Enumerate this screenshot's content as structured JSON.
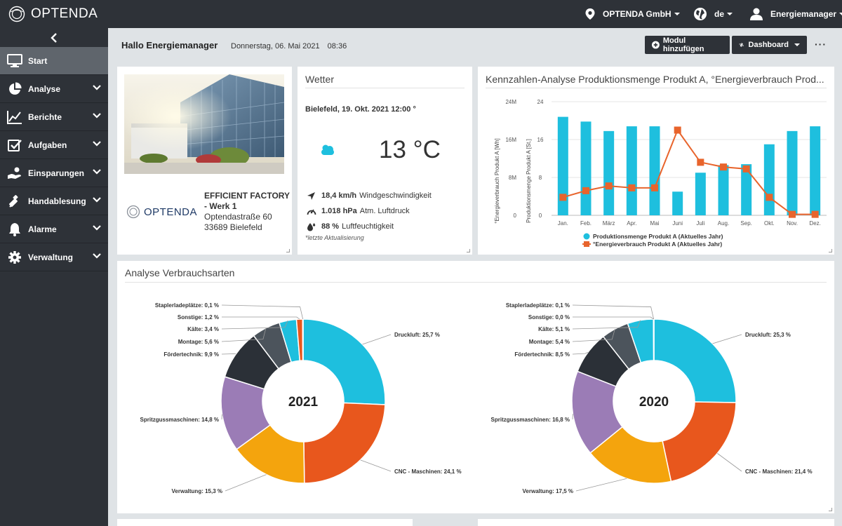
{
  "topbar": {
    "logo_text": "OPTENDA",
    "company": "OPTENDA GmbH",
    "language": "de",
    "user": "Energiemanager"
  },
  "sidebar": {
    "items": [
      {
        "label": "Start",
        "icon": "monitor-icon"
      },
      {
        "label": "Analyse",
        "icon": "pie-chart-icon"
      },
      {
        "label": "Berichte",
        "icon": "line-chart-icon"
      },
      {
        "label": "Aufgaben",
        "icon": "checkbox-icon"
      },
      {
        "label": "Einsparungen",
        "icon": "savings-hand-icon"
      },
      {
        "label": "Handablesung",
        "icon": "meter-icon"
      },
      {
        "label": "Alarme",
        "icon": "bell-icon"
      },
      {
        "label": "Verwaltung",
        "icon": "gear-icon"
      }
    ]
  },
  "header": {
    "greeting": "Hallo Energiemanager",
    "date": "Donnerstag, 06. Mai 2021",
    "time": "08:36",
    "add_module_label": "Modul hinzufügen",
    "dashboard_label": "Dashboard",
    "more_label": "···"
  },
  "factory": {
    "name_line1": "EFFICIENT FACTORY",
    "name_line2": "- Werk 1",
    "street": "Optendastraße 60",
    "city": "33689 Bielefeld",
    "logo_text": "OPTENDA"
  },
  "weather": {
    "title": "Wetter",
    "location": "Bielefeld, 19. Okt. 2021 12:00 °",
    "temperature": "13 °C",
    "wind_value": "18,4 km/h",
    "wind_label": "Windgeschwindigkeit",
    "pressure_value": "1.018 hPa",
    "pressure_label": "Atm. Luftdruck",
    "humidity_value": "88 %",
    "humidity_label": "Luftfeuchtigkeit",
    "note": "*letzte Aktualisierung"
  },
  "analysis_card": {
    "title": "Analyse Verbrauchsarten"
  },
  "chart_data": [
    {
      "type": "bar",
      "title": "Kennzahlen-Analyse Produktionsmenge Produkt A, °Energieverbrauch Prod...",
      "categories": [
        "Jan.",
        "Feb.",
        "März",
        "Apr.",
        "Mai",
        "Juni",
        "Juli",
        "Aug.",
        "Sep.",
        "Okt.",
        "Nov.",
        "Dez."
      ],
      "y_left_label": "°Energieverbrauch Produkt A [Wh]",
      "y_left_ticks": [
        "0",
        "8M",
        "16M",
        "24M"
      ],
      "y_left_lim": [
        0,
        24000000
      ],
      "y_right_label": "Produktionsmenge Produkt A [St.]",
      "y_right_ticks": [
        "0",
        "8",
        "16",
        "24"
      ],
      "y_right_lim": [
        0,
        24
      ],
      "grid": true,
      "legend_position": "bottom",
      "series": [
        {
          "name": "Produktionsmenge Produkt A (Aktuelles Jahr)",
          "kind": "bar",
          "axis": "right",
          "color": "#1ebfde",
          "values": [
            20.8,
            19.8,
            17.8,
            18.8,
            18.8,
            5,
            9,
            10.6,
            10.8,
            15,
            17.8,
            18.8
          ]
        },
        {
          "name": "°Energieverbrauch Produkt A (Aktuelles Jahr)",
          "kind": "line",
          "axis": "right",
          "color": "#e8642c",
          "values": [
            3.8,
            5.2,
            6.2,
            5.8,
            5.8,
            18,
            11.2,
            10.2,
            9.8,
            3.8,
            0.2,
            0.2
          ]
        }
      ]
    },
    {
      "type": "pie",
      "title": "2021",
      "slices": [
        {
          "label": "Druckluft",
          "value": 25.7,
          "display": "Druckluft: 25,7 %",
          "color": "#1ebfde"
        },
        {
          "label": "CNC - Maschinen",
          "value": 24.1,
          "display": "CNC - Maschinen: 24,1 %",
          "color": "#e8571d"
        },
        {
          "label": "Verwaltung",
          "value": 15.3,
          "display": "Verwaltung: 15,3 %",
          "color": "#f4a40d"
        },
        {
          "label": "Spritzgussmaschinen",
          "value": 14.8,
          "display": "Spritzgussmaschinen: 14,8 %",
          "color": "#9b7cb6"
        },
        {
          "label": "Fördertechnik",
          "value": 9.9,
          "display": "Fördertechnik: 9,9 %",
          "color": "#2b3037"
        },
        {
          "label": "Montage",
          "value": 5.6,
          "display": "Montage: 5,6 %",
          "color": "#4c545c"
        },
        {
          "label": "Kälte",
          "value": 3.4,
          "display": "Kälte: 3,4 %",
          "color": "#1ebfde"
        },
        {
          "label": "Sonstige",
          "value": 1.2,
          "display": "Sonstige: 1,2 %",
          "color": "#e8571d"
        },
        {
          "label": "Staplerladeplätze",
          "value": 0.1,
          "display": "Staplerladeplätze: 0,1 %",
          "color": "#f4a40d"
        }
      ]
    },
    {
      "type": "pie",
      "title": "2020",
      "slices": [
        {
          "label": "Druckluft",
          "value": 25.3,
          "display": "Druckluft: 25,3 %",
          "color": "#1ebfde"
        },
        {
          "label": "CNC - Maschinen",
          "value": 21.4,
          "display": "CNC - Maschinen: 21,4 %",
          "color": "#e8571d"
        },
        {
          "label": "Verwaltung",
          "value": 17.5,
          "display": "Verwaltung: 17,5 %",
          "color": "#f4a40d"
        },
        {
          "label": "Spritzgussmaschinen",
          "value": 16.8,
          "display": "Spritzgussmaschinen: 16,8 %",
          "color": "#9b7cb6"
        },
        {
          "label": "Fördertechnik",
          "value": 8.5,
          "display": "Fördertechnik: 8,5 %",
          "color": "#2b3037"
        },
        {
          "label": "Montage",
          "value": 5.4,
          "display": "Montage: 5,4 %",
          "color": "#4c545c"
        },
        {
          "label": "Kälte",
          "value": 5.1,
          "display": "Kälte: 5,1 %",
          "color": "#1ebfde"
        },
        {
          "label": "Sonstige",
          "value": 0.0,
          "display": "Sonstige: 0,0 %",
          "color": "#e8571d"
        },
        {
          "label": "Staplerladeplätze",
          "value": 0.1,
          "display": "Staplerladeplätze: 0,1 %",
          "color": "#f4a40d"
        }
      ]
    }
  ]
}
